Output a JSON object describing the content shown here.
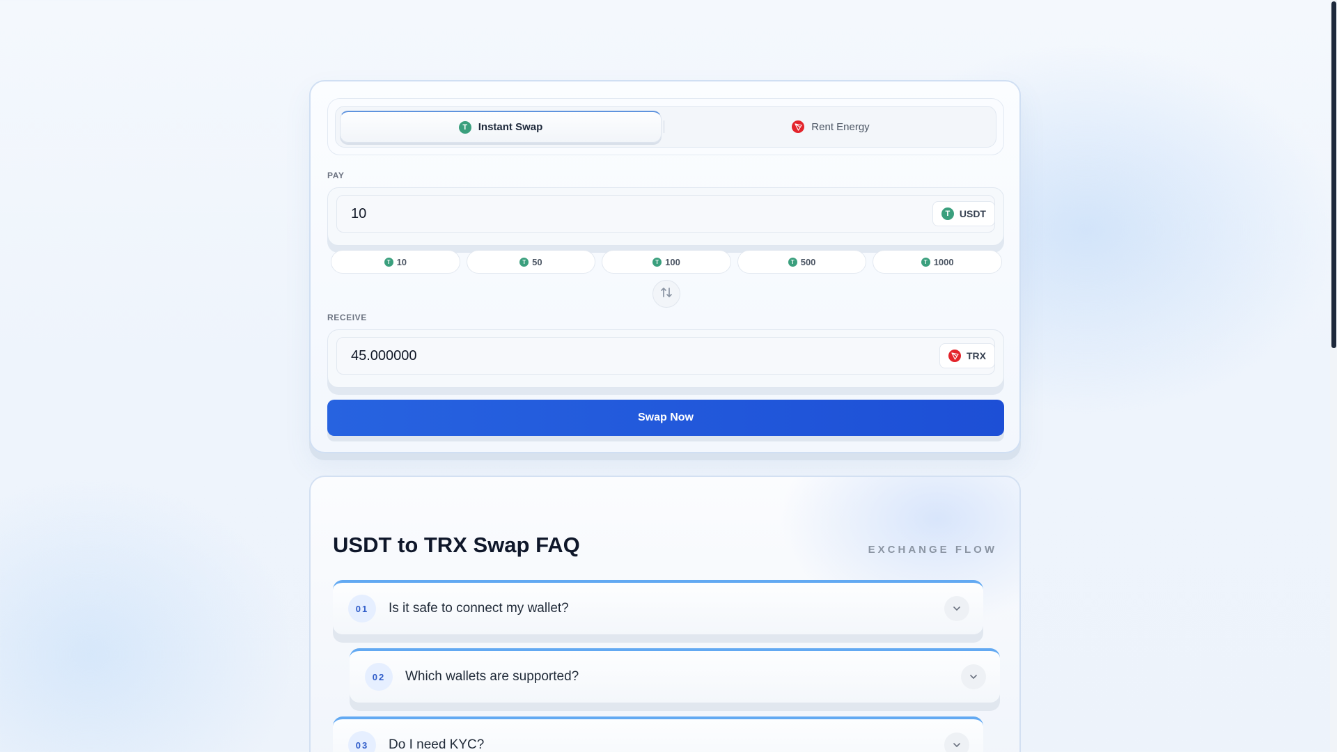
{
  "tabs": [
    {
      "label": "Instant Swap",
      "icon": "usdt-icon",
      "active": true
    },
    {
      "label": "Rent Energy",
      "icon": "trx-icon",
      "active": false
    }
  ],
  "pay": {
    "label": "PAY",
    "value": "10",
    "token": "USDT",
    "coin_glyph": "T"
  },
  "quick_amounts": [
    "10",
    "50",
    "100",
    "500",
    "1000"
  ],
  "receive": {
    "label": "RECEIVE",
    "value": "45.000000",
    "token": "TRX"
  },
  "swap_button": "Swap Now",
  "faq": {
    "title": "USDT to TRX Swap FAQ",
    "kicker": "EXCHANGE FLOW",
    "items": [
      {
        "num": "01",
        "question": "Is it safe to connect my wallet?"
      },
      {
        "num": "02",
        "question": "Which wallets are supported?"
      },
      {
        "num": "03",
        "question": "Do I need KYC?"
      }
    ]
  },
  "colors": {
    "accent": "#2563eb",
    "usdt": "#3a9f7d",
    "trx": "#e3242b",
    "faq_border": "#62a9f2"
  }
}
